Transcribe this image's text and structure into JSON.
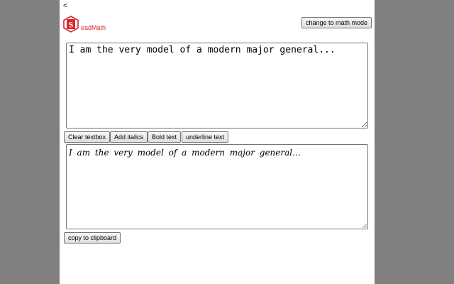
{
  "nav": {
    "back_symbol": "<"
  },
  "logo": {
    "letter": "S",
    "text": "eadMath",
    "color": "#d8262a"
  },
  "header": {
    "mode_button_label": "change to math mode"
  },
  "editor": {
    "value": "I am the very model of a modern major general..."
  },
  "toolbar": {
    "clear_label": "Clear textbox",
    "italics_label": "Add italics",
    "bold_label": "Bold text",
    "underline_label": "underline text"
  },
  "preview": {
    "rendered_text": "I am the very model of a modern major general..."
  },
  "footer": {
    "copy_label": "copy to clipboard"
  },
  "colors": {
    "outer_background": "#808080",
    "page_background": "#ffffff",
    "brand_red": "#d8262a"
  }
}
